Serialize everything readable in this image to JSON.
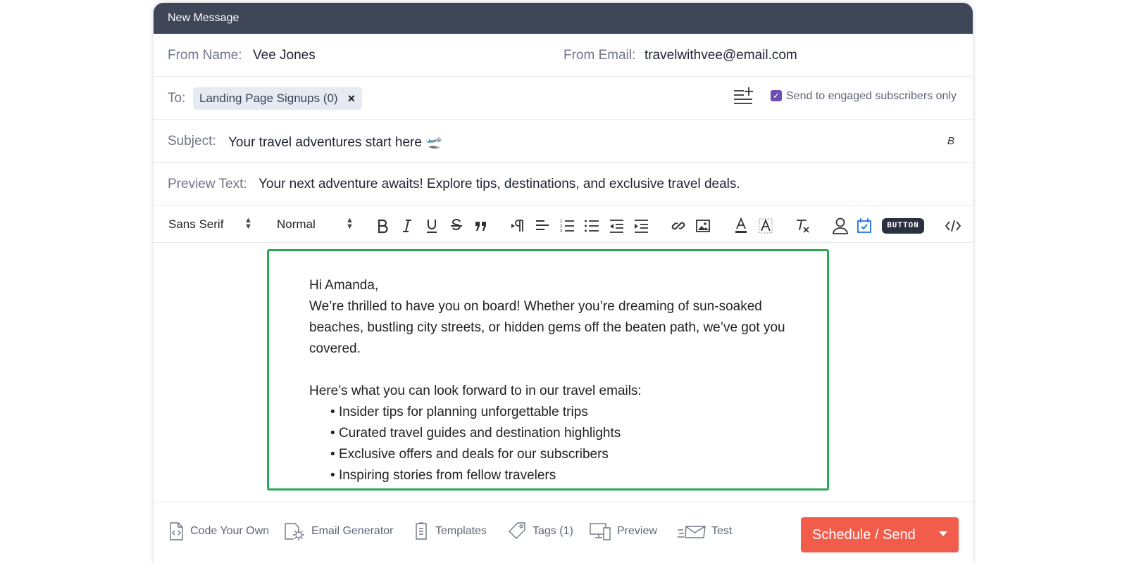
{
  "window": {
    "title": "New Message"
  },
  "from": {
    "name_label": "From Name:",
    "name_value": "Vee Jones",
    "email_label": "From Email:",
    "email_value": "travelwithvee@email.com"
  },
  "to": {
    "label": "To:",
    "chip": "Landing Page Signups (0)",
    "chip_remove": "×",
    "engaged_label": "Send to engaged subscribers only",
    "engaged_checked": true
  },
  "subject": {
    "label": "Subject:",
    "value": "Your travel adventures start here 🛫",
    "format_icon": "B"
  },
  "preview": {
    "label": "Preview Text:",
    "value": "Your next adventure awaits! Explore tips, destinations, and exclusive travel deals."
  },
  "toolbar": {
    "font": "Sans Serif",
    "size": "Normal",
    "button_label": "BUTTON",
    "accent": "#1a73e8"
  },
  "email_body": {
    "greeting": "Hi Amanda,",
    "intro": "We’re thrilled to have you on board! Whether you’re dreaming of sun-soaked beaches, bustling city streets, or hidden gems off the beaten path, we’ve got you covered.",
    "lead": "Here’s what you can look forward to in our travel emails:",
    "bullets": [
      "Insider tips for planning unforgettable trips",
      "Curated travel guides and destination highlights",
      "Exclusive offers and deals for our subscribers",
      "Inspiring stories from fellow travelers"
    ]
  },
  "footer": {
    "code_your_own": "Code Your Own",
    "email_generator": "Email Generator",
    "templates": "Templates",
    "tags": "Tags (1)",
    "preview": "Preview",
    "test": "Test",
    "send": "Schedule / Send"
  },
  "colors": {
    "titlebar": "#3f4658",
    "send_button": "#f25c4a",
    "editor_border": "#2aa856",
    "checkbox": "#6b4fb5"
  }
}
